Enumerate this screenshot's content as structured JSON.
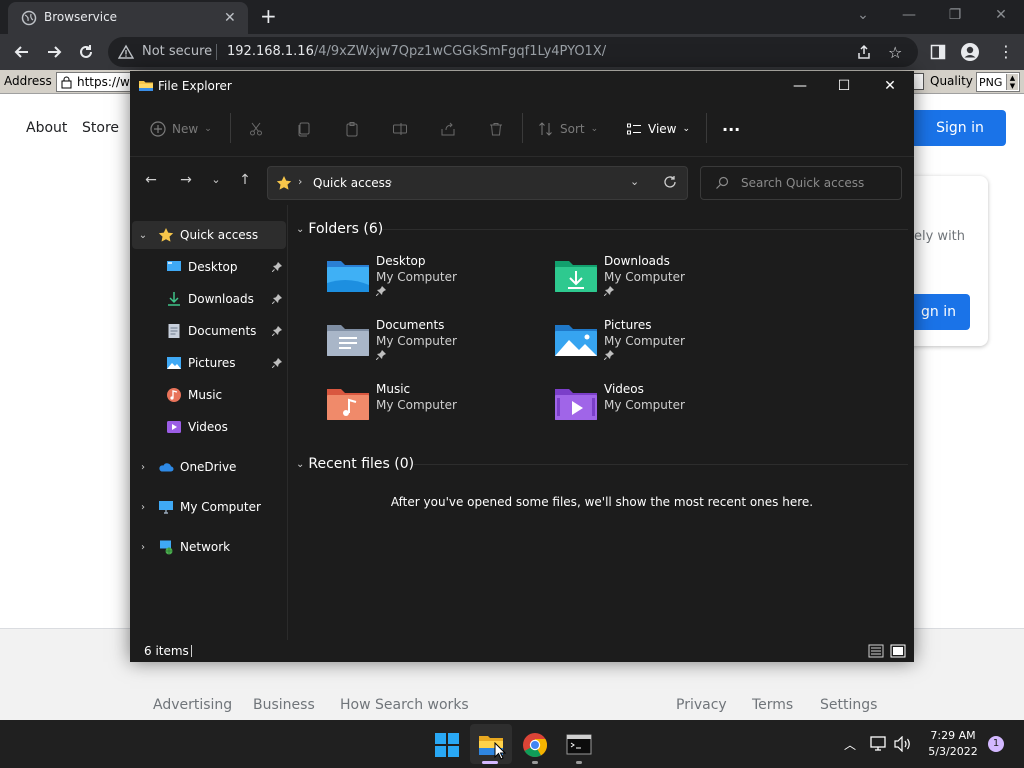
{
  "browser": {
    "tab_title": "Browservice",
    "security_label": "Not secure",
    "url_host": "192.168.1.16",
    "url_path": "/4/9xZWxjw7Qpz1wCGGkSmFgqf1Ly4PYO1X/"
  },
  "addressbar": {
    "address_label": "Address",
    "address_value": "https://w",
    "quality_label": "Quality",
    "quality_value": "PNG"
  },
  "webpage": {
    "nav": [
      "About",
      "Store"
    ],
    "sign_in": "Sign in",
    "card_text": "ely with",
    "card_button": "gn in",
    "footer_left": [
      "Advertising",
      "Business",
      "How Search works"
    ],
    "footer_right": [
      "Privacy",
      "Terms",
      "Settings"
    ]
  },
  "explorer": {
    "title": "File Explorer",
    "commands": {
      "new": "New",
      "sort": "Sort",
      "view": "View",
      "more": "..."
    },
    "breadcrumb": "Quick access",
    "search_placeholder": "Search Quick access",
    "sidebar": {
      "quick_access": "Quick access",
      "pinned": [
        "Desktop",
        "Downloads",
        "Documents",
        "Pictures"
      ],
      "others": [
        "Music",
        "Videos"
      ],
      "roots": [
        "OneDrive",
        "My Computer",
        "Network"
      ]
    },
    "folders_header": "Folders (6)",
    "folders": [
      {
        "name": "Desktop",
        "location": "My Computer"
      },
      {
        "name": "Downloads",
        "location": "My Computer"
      },
      {
        "name": "Documents",
        "location": "My Computer"
      },
      {
        "name": "Pictures",
        "location": "My Computer"
      },
      {
        "name": "Music",
        "location": "My Computer"
      },
      {
        "name": "Videos",
        "location": "My Computer"
      }
    ],
    "recent_header": "Recent files (0)",
    "recent_empty": "After you've opened some files, we'll show the most recent ones here.",
    "status": "6 items"
  },
  "taskbar": {
    "time": "7:29 AM",
    "date": "5/3/2022",
    "notifications": "1"
  }
}
